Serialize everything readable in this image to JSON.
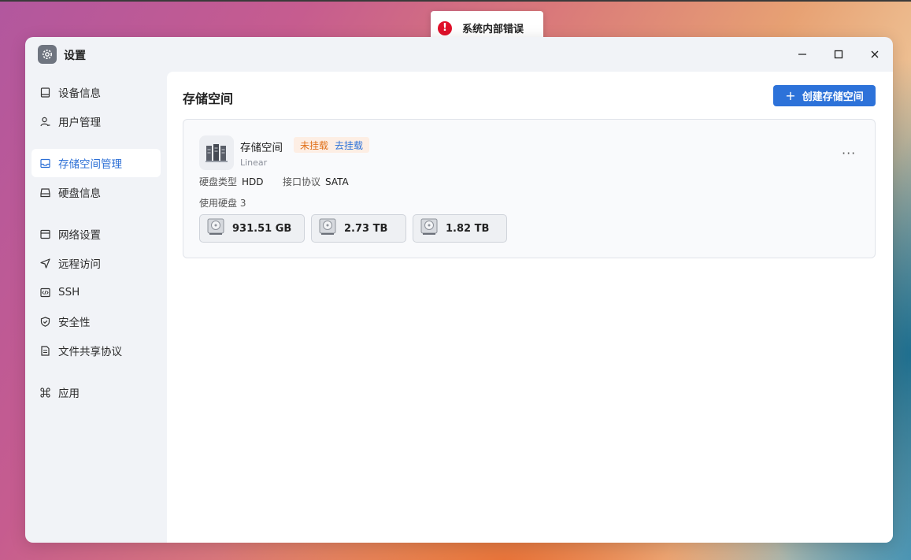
{
  "toast": {
    "icon": "error-icon",
    "message": "系统内部错误"
  },
  "window": {
    "title": "设置",
    "icon": "gear-icon",
    "controls": [
      "minimize-icon",
      "maximize-icon",
      "close-icon"
    ]
  },
  "sidebar": {
    "items": [
      {
        "label": "设备信息",
        "icon": "device-icon",
        "active": false
      },
      {
        "label": "用户管理",
        "icon": "user-icon",
        "active": false
      },
      {
        "label": "存储空间管理",
        "icon": "storage-icon",
        "active": true
      },
      {
        "label": "硬盘信息",
        "icon": "disk-icon",
        "active": false
      },
      {
        "label": "网络设置",
        "icon": "network-icon",
        "active": false
      },
      {
        "label": "远程访问",
        "icon": "send-icon",
        "active": false
      },
      {
        "label": "SSH",
        "icon": "code-icon",
        "active": false
      },
      {
        "label": "安全性",
        "icon": "shield-icon",
        "active": false
      },
      {
        "label": "文件共享协议",
        "icon": "document-icon",
        "active": false
      },
      {
        "label": "应用",
        "icon": "command-icon",
        "active": false
      }
    ]
  },
  "main": {
    "title": "存储空间",
    "create_button": {
      "icon": "plus-icon",
      "label": "创建存储空间"
    },
    "pool": {
      "name": "存储空间",
      "status": "未挂载",
      "mount_action": "去挂载",
      "raid": "Linear",
      "disk_type_label": "硬盘类型",
      "disk_type": "HDD",
      "interface_label": "接口协议",
      "interface": "SATA",
      "disks_used_label": "使用硬盘 3",
      "disks": [
        {
          "size": "931.51 GB"
        },
        {
          "size": "2.73 TB"
        },
        {
          "size": "1.82 TB"
        }
      ],
      "more_icon": "more-horizontal-icon"
    }
  },
  "colors": {
    "accent": "#2d72d9",
    "error": "#e0102a",
    "warning": "#e0711b"
  }
}
